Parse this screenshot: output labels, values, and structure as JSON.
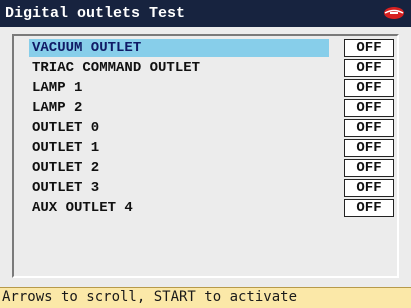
{
  "window": {
    "title": "Digital outlets Test",
    "logo_icon": "brand-logo-icon"
  },
  "outlets": [
    {
      "label": "VACUUM OUTLET",
      "state": "OFF",
      "selected": true
    },
    {
      "label": "TRIAC COMMAND OUTLET",
      "state": "OFF",
      "selected": false
    },
    {
      "label": "LAMP 1",
      "state": "OFF",
      "selected": false
    },
    {
      "label": "LAMP 2",
      "state": "OFF",
      "selected": false
    },
    {
      "label": "OUTLET 0",
      "state": "OFF",
      "selected": false
    },
    {
      "label": "OUTLET 1",
      "state": "OFF",
      "selected": false
    },
    {
      "label": "OUTLET 2",
      "state": "OFF",
      "selected": false
    },
    {
      "label": "OUTLET 3",
      "state": "OFF",
      "selected": false
    },
    {
      "label": "AUX OUTLET 4",
      "state": "OFF",
      "selected": false
    }
  ],
  "status_bar": {
    "hint": "Arrows to scroll, START to activate"
  },
  "colors": {
    "title_bar": "#17233f",
    "selection": "#87ceea",
    "status_bar": "#fbe8a8",
    "logo": "#d62020"
  }
}
